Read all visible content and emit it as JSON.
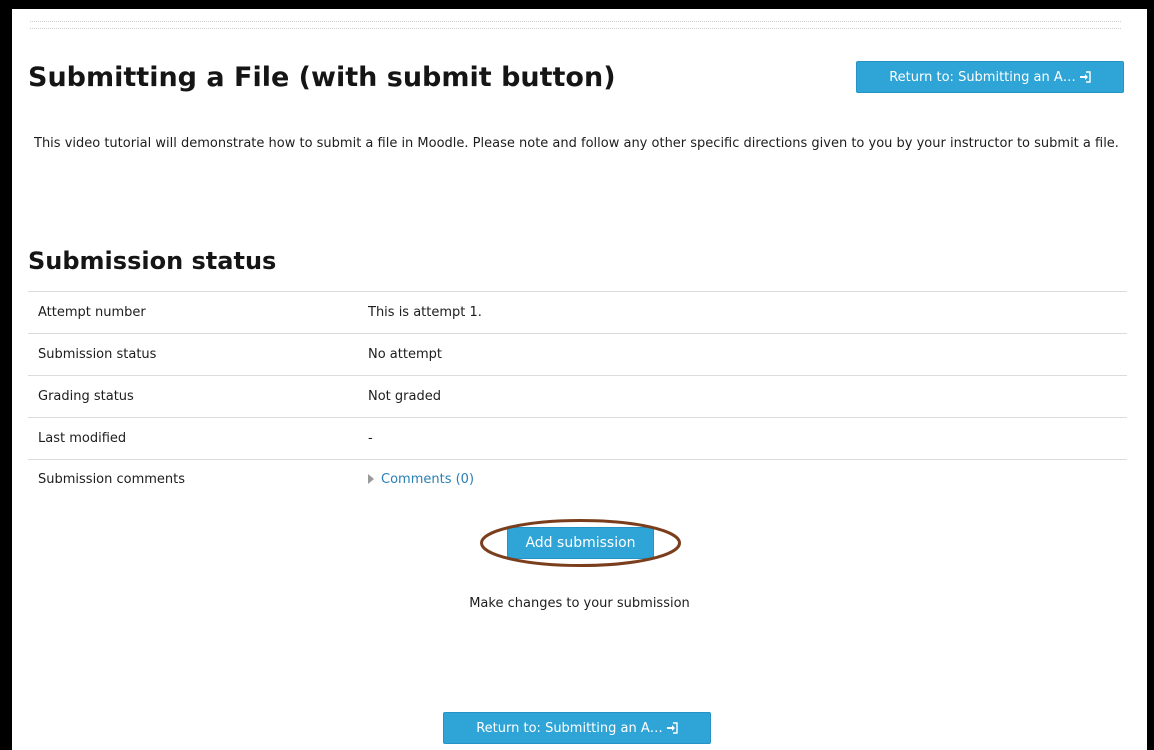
{
  "page": {
    "title": "Submitting a File (with submit button)",
    "return_button_label": "Return to: Submitting an A…",
    "intro": "This video tutorial will demonstrate how to submit a file in Moodle. Please note and follow any other specific directions given to you by your instructor to submit a file."
  },
  "submission_status": {
    "heading": "Submission status",
    "rows": [
      {
        "label": "Attempt number",
        "value": "This is attempt 1."
      },
      {
        "label": "Submission status",
        "value": "No attempt"
      },
      {
        "label": "Grading status",
        "value": "Not graded"
      },
      {
        "label": "Last modified",
        "value": "-"
      },
      {
        "label": "Submission comments",
        "value": "Comments (0)"
      }
    ],
    "add_button_label": "Add submission",
    "helper_text": "Make changes to your submission"
  },
  "colors": {
    "button_bg": "#2fa4d6",
    "link": "#2a7fb5",
    "annotation_ring": "#7a3e1d"
  },
  "icons": {
    "return": "enter-icon",
    "expand": "triangle-right-icon"
  }
}
